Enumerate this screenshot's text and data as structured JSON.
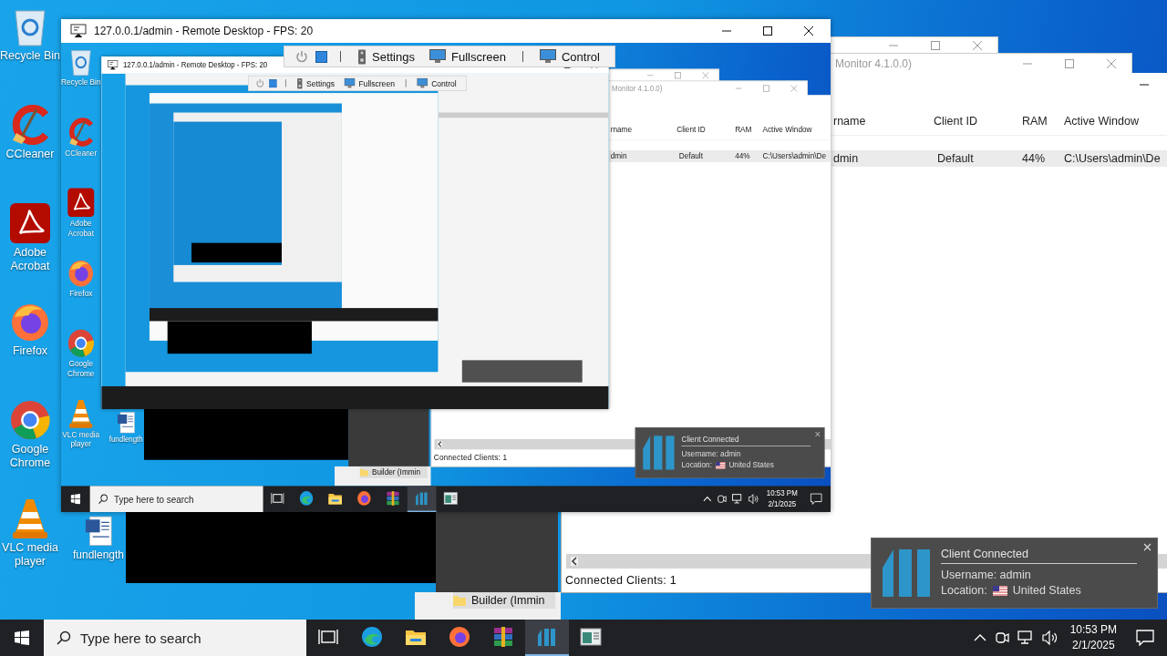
{
  "desktop": {
    "icons": [
      {
        "kind": "recycle-bin",
        "label": "Recycle Bin"
      },
      {
        "kind": "ccleaner",
        "label": "CCleaner"
      },
      {
        "kind": "acrobat",
        "label": "Adobe Acrobat"
      },
      {
        "kind": "firefox",
        "label": "Firefox"
      },
      {
        "kind": "chrome",
        "label": "Google Chrome"
      },
      {
        "kind": "vlc",
        "label": "VLC media player"
      },
      {
        "kind": "document",
        "label": "fundlength"
      }
    ],
    "monitor_windows": {
      "title": "Monitor 4.1.0.0)",
      "columns": [
        "rname",
        "Client ID",
        "RAM",
        "Active Window"
      ],
      "row": [
        "dmin",
        "Default",
        "44%",
        "C:\\Users\\admin\\De"
      ],
      "status": "Connected Clients: 1"
    },
    "explorer": {
      "item": "Builder (Immin"
    },
    "remote_window": {
      "title": "127.0.0.1/admin - Remote Desktop - FPS: 20",
      "toolbar": [
        {
          "kind": "power"
        },
        {
          "kind": "screen"
        },
        {
          "kind": "separator"
        },
        {
          "kind": "settings",
          "label": "Settings"
        },
        {
          "kind": "fullscreen",
          "label": "Fullscreen"
        },
        {
          "kind": "separator"
        },
        {
          "kind": "control",
          "label": "Control"
        }
      ],
      "screen": {
        "icons": [
          {
            "kind": "recycle-bin",
            "label": "Recycle Bin"
          },
          {
            "kind": "ccleaner",
            "label": "CCleaner"
          },
          {
            "kind": "acrobat",
            "label": "Adobe Acrobat"
          },
          {
            "kind": "firefox",
            "label": "Firefox"
          },
          {
            "kind": "chrome",
            "label": "Google Chrome"
          },
          {
            "kind": "vlc",
            "label": "VLC media player"
          },
          {
            "kind": "document",
            "label": "fundlength"
          }
        ],
        "monitor_windows": {
          "title": "Monitor 4.1.0.0)",
          "columns": [
            "rname",
            "Client ID",
            "RAM",
            "Active Window"
          ],
          "row": [
            "dmin",
            "Default",
            "44%",
            "C:\\Users\\admin\\De"
          ],
          "status": "Connected Clients: 1"
        },
        "explorer": {
          "item": "Builder (Immin"
        },
        "remote_window": {
          "title": "127.0.0.1/admin - Remote Desktop - FPS: 20",
          "toolbar": [
            {
              "kind": "power"
            },
            {
              "kind": "screen"
            },
            {
              "kind": "separator"
            },
            {
              "kind": "settings",
              "label": "Settings"
            },
            {
              "kind": "fullscreen",
              "label": "Fullscreen"
            },
            {
              "kind": "separator"
            },
            {
              "kind": "control",
              "label": "Control"
            }
          ]
        },
        "notification": {
          "title": "Client Connected",
          "username": "Username: admin",
          "location_label": "Location:",
          "location": "United States"
        },
        "taskbar": {
          "search": {
            "placeholder": "Type here to search"
          },
          "apps": [
            {
              "kind": "task-view",
              "selected": false
            },
            {
              "kind": "edge",
              "selected": false
            },
            {
              "kind": "explorer",
              "selected": false
            },
            {
              "kind": "firefox",
              "selected": false
            },
            {
              "kind": "winrar",
              "selected": false
            },
            {
              "kind": "monitor-app",
              "selected": true
            },
            {
              "kind": "window-app",
              "selected": false
            }
          ],
          "time": "10:53 PM",
          "date": "2/1/2025"
        }
      }
    },
    "notification": {
      "title": "Client Connected",
      "username": "Username: admin",
      "location_label": "Location:",
      "location": "United States"
    },
    "taskbar": {
      "search": {
        "placeholder": "Type here to search"
      },
      "apps": [
        {
          "kind": "task-view",
          "selected": false
        },
        {
          "kind": "edge",
          "selected": false
        },
        {
          "kind": "explorer",
          "selected": false
        },
        {
          "kind": "firefox",
          "selected": false
        },
        {
          "kind": "winrar",
          "selected": false
        },
        {
          "kind": "monitor-app",
          "selected": true
        },
        {
          "kind": "window-app",
          "selected": false
        }
      ],
      "time": "10:53 PM",
      "date": "2/1/2025"
    }
  }
}
